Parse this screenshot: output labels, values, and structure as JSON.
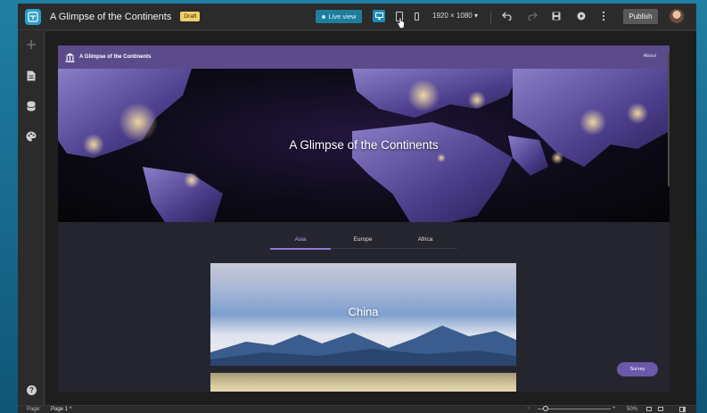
{
  "app": {
    "title": "A Glimpse of the Continents",
    "draft_badge": "Draft",
    "live_view_label": "Live view",
    "resolution": "1920 × 1080",
    "publish_label": "Publish"
  },
  "site": {
    "header_title": "A Glimpse of the Continents",
    "about_label": "About",
    "hero_title": "A Glimpse of the Continents",
    "tabs": [
      {
        "label": "Asia",
        "active": true
      },
      {
        "label": "Europe",
        "active": false
      },
      {
        "label": "Africa",
        "active": false
      }
    ],
    "card_label": "China",
    "survey_label": "Survey"
  },
  "bottom": {
    "page_label": "Page:",
    "page_value": "Page 1",
    "zoom_level": "50%"
  },
  "colors": {
    "accent": "#1d8cb5",
    "site_header": "#5c4b8b",
    "tab_active": "#b9a6ff",
    "survey": "#6a58a8",
    "draft_badge": "#f0cf6a"
  }
}
